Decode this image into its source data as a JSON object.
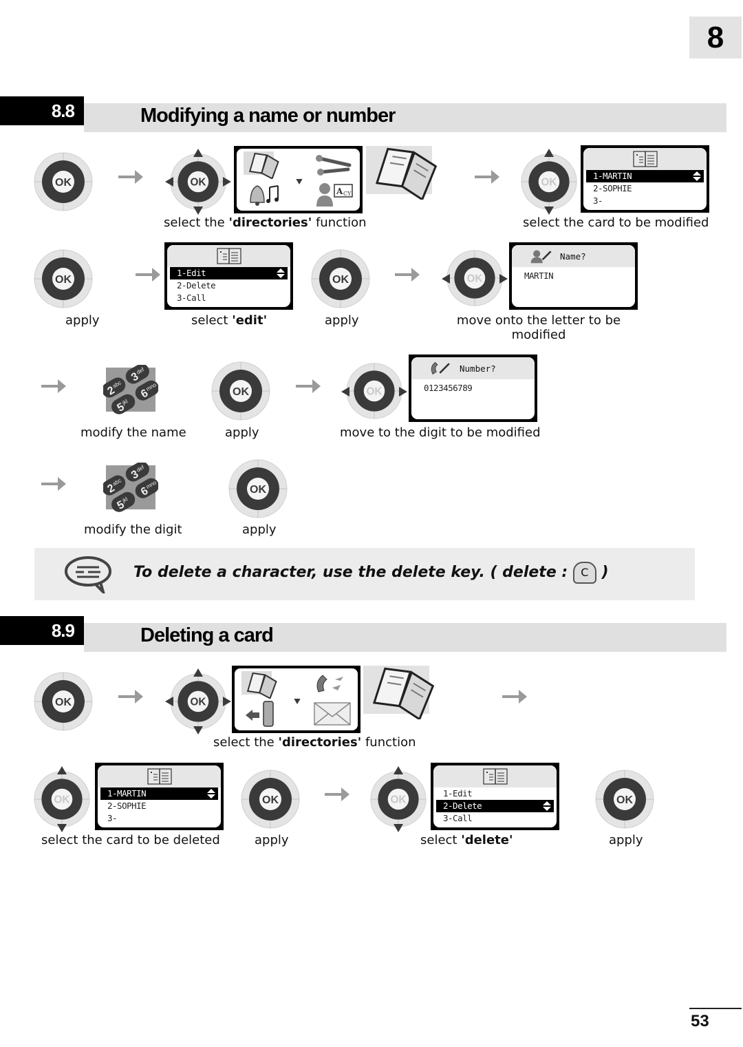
{
  "page": {
    "chapter_number": "8",
    "page_number": "53"
  },
  "section_88": {
    "number": "8.8",
    "title": "Modifying a name or number",
    "steps": {
      "select_directories": {
        "pre": "select the ",
        "bold": "'directories'",
        "post": " function"
      },
      "select_card_modified": "select the card to be modified",
      "apply": "apply",
      "select_edit": {
        "pre": "select ",
        "bold": "'edit'"
      },
      "move_letter_line1": "move onto the letter to be",
      "move_letter_line2": "modified",
      "modify_name": "modify the name",
      "move_digit": "move to the digit to be modified",
      "modify_digit": "modify the digit"
    },
    "screens": {
      "card_list": [
        "1-MARTIN",
        "2-SOPHIE",
        "3-"
      ],
      "card_menu": [
        "1-Edit",
        "2-Delete",
        "3-Call"
      ],
      "name_prompt": {
        "label": "Name?",
        "value": "MARTIN"
      },
      "number_prompt": {
        "label": "Number?",
        "value": "0123456789"
      }
    },
    "ok_label": "OK",
    "keypad_keys": [
      "2abc",
      "3def",
      "5jkl",
      "6mno"
    ]
  },
  "note": {
    "text": "To delete a character, use the delete key. ( delete : ",
    "key_label": "C",
    "close": " )"
  },
  "section_89": {
    "number": "8.9",
    "title": "Deleting a card",
    "steps": {
      "select_directories": {
        "pre": "select the ",
        "bold": "'directories'",
        "post": " function"
      },
      "select_card_deleted": "select the card to be deleted",
      "apply": "apply",
      "select_delete": {
        "pre": "select ",
        "bold": "'delete'"
      }
    },
    "screens": {
      "card_list": [
        "1-MARTIN",
        "2-SOPHIE",
        "3-"
      ],
      "card_menu": [
        "1-Edit",
        "2-Delete",
        "3-Call"
      ]
    }
  },
  "colors": {
    "section_bar": "#e0e0e0",
    "note_bg": "#ececec",
    "arrow": "#9a9a9a",
    "nav_dark": "#3a3a3a"
  }
}
